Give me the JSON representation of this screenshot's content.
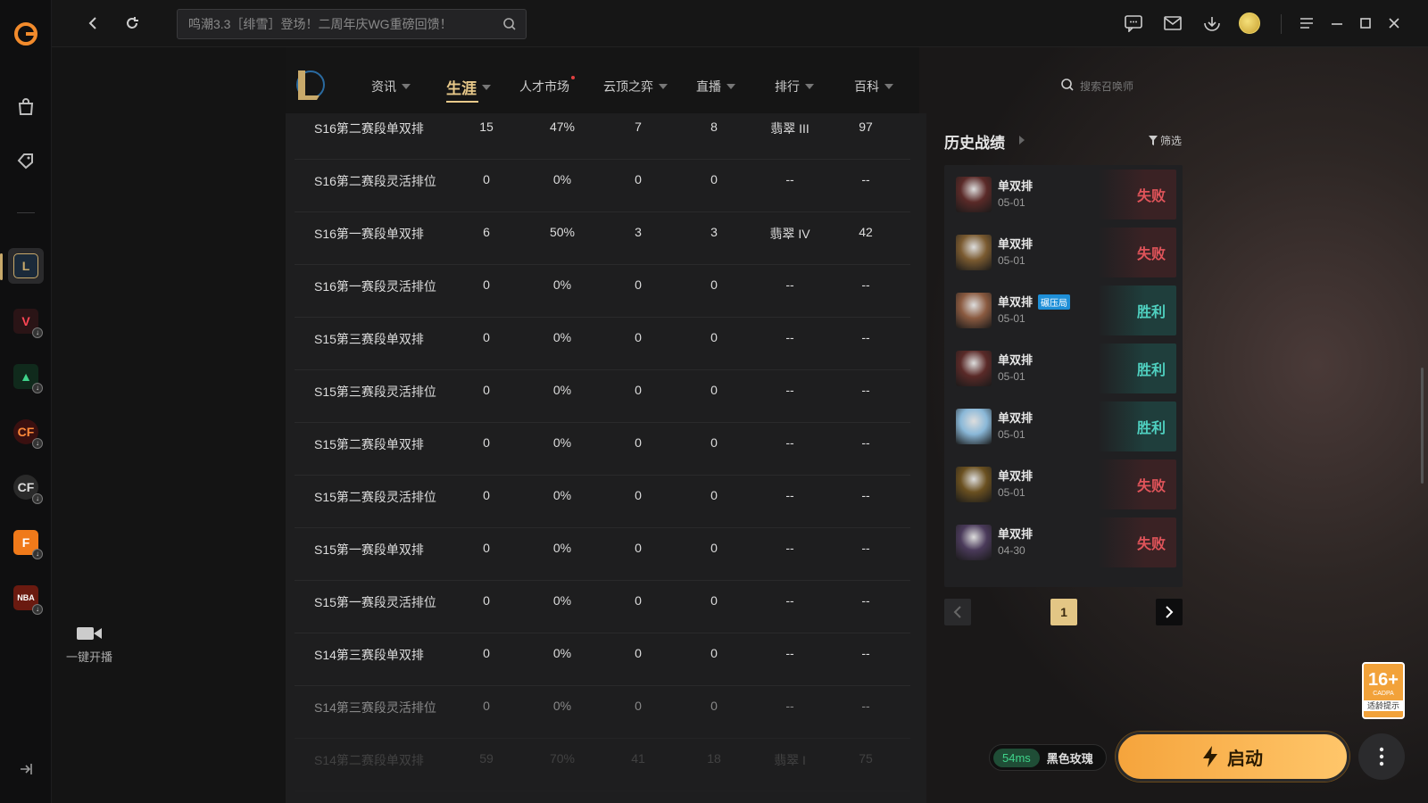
{
  "topbar": {
    "search_placeholder": "鸣潮3.3［绯雪］登场！二周年庆WG重磅回馈！"
  },
  "sidebar": {
    "go_live_label": "一键开播"
  },
  "nav": {
    "items": [
      {
        "label": "资讯",
        "has_caret": true,
        "active": false
      },
      {
        "label": "生涯",
        "has_caret": true,
        "active": true
      },
      {
        "label": "人才市场",
        "has_caret": false,
        "active": false,
        "new_dot": true
      },
      {
        "label": "云顶之弈",
        "has_caret": true,
        "active": false
      },
      {
        "label": "直播",
        "has_caret": true,
        "active": false
      },
      {
        "label": "排行",
        "has_caret": true,
        "active": false
      },
      {
        "label": "百科",
        "has_caret": true,
        "active": false
      }
    ],
    "search_placeholder": "搜索召唤师"
  },
  "stats_rows": [
    [
      "S16第二赛段单双排",
      "15",
      "47%",
      "7",
      "8",
      "翡翠 III",
      "97"
    ],
    [
      "S16第二赛段灵活排位",
      "0",
      "0%",
      "0",
      "0",
      "--",
      "--"
    ],
    [
      "S16第一赛段单双排",
      "6",
      "50%",
      "3",
      "3",
      "翡翠 IV",
      "42"
    ],
    [
      "S16第一赛段灵活排位",
      "0",
      "0%",
      "0",
      "0",
      "--",
      "--"
    ],
    [
      "S15第三赛段单双排",
      "0",
      "0%",
      "0",
      "0",
      "--",
      "--"
    ],
    [
      "S15第三赛段灵活排位",
      "0",
      "0%",
      "0",
      "0",
      "--",
      "--"
    ],
    [
      "S15第二赛段单双排",
      "0",
      "0%",
      "0",
      "0",
      "--",
      "--"
    ],
    [
      "S15第二赛段灵活排位",
      "0",
      "0%",
      "0",
      "0",
      "--",
      "--"
    ],
    [
      "S15第一赛段单双排",
      "0",
      "0%",
      "0",
      "0",
      "--",
      "--"
    ],
    [
      "S15第一赛段灵活排位",
      "0",
      "0%",
      "0",
      "0",
      "--",
      "--"
    ],
    [
      "S14第三赛段单双排",
      "0",
      "0%",
      "0",
      "0",
      "--",
      "--"
    ],
    [
      "S14第三赛段灵活排位",
      "0",
      "0%",
      "0",
      "0",
      "--",
      "--"
    ],
    [
      "S14第二赛段单双排",
      "59",
      "70%",
      "41",
      "18",
      "翡翠 I",
      "75"
    ]
  ],
  "history": {
    "title": "历史战绩",
    "filter_label": "筛选",
    "matches": [
      {
        "mode": "单双排",
        "date": "05-01",
        "result": "失败",
        "win": false,
        "tag": "",
        "avatar_color": "#5a2a28"
      },
      {
        "mode": "单双排",
        "date": "05-01",
        "result": "失败",
        "win": false,
        "tag": "",
        "avatar_color": "#7a5a30"
      },
      {
        "mode": "单双排",
        "date": "05-01",
        "result": "胜利",
        "win": true,
        "tag": "碾压局",
        "avatar_color": "#8a5a40"
      },
      {
        "mode": "单双排",
        "date": "05-01",
        "result": "胜利",
        "win": true,
        "tag": "",
        "avatar_color": "#5a2a28"
      },
      {
        "mode": "单双排",
        "date": "05-01",
        "result": "胜利",
        "win": true,
        "tag": "",
        "avatar_color": "#8ab8d8"
      },
      {
        "mode": "单双排",
        "date": "05-01",
        "result": "失败",
        "win": false,
        "tag": "",
        "avatar_color": "#6a5020"
      },
      {
        "mode": "单双排",
        "date": "04-30",
        "result": "失败",
        "win": false,
        "tag": "",
        "avatar_color": "#4a3a5a"
      }
    ],
    "current_page": "1"
  },
  "age_rating": {
    "big": "16+",
    "small": "CADPA",
    "label": "适龄提示"
  },
  "launch": {
    "ping": "54ms",
    "server": "黑色玫瑰",
    "button_label": "启动"
  },
  "colors": {
    "accent_gold": "#e8c98a",
    "loss": "#e0545a",
    "win": "#4fd0c0",
    "launch": "#f5a43c"
  }
}
